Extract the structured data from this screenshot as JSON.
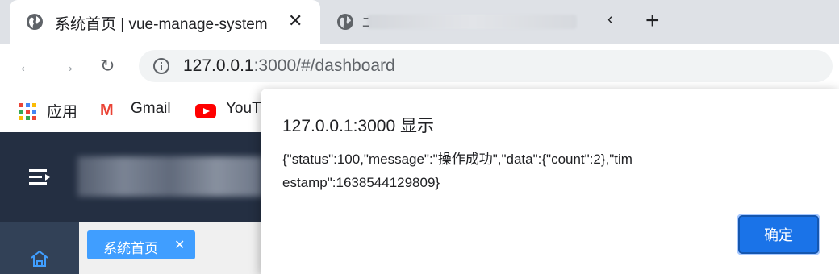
{
  "browser": {
    "active_tab": {
      "title": "系统首页 | vue-manage-system",
      "close_glyph": "✕"
    },
    "second_tab": {
      "title_fragment": "ﾆ",
      "overflow_glyph": "‹"
    },
    "new_tab_glyph": "+",
    "nav": {
      "back_glyph": "←",
      "forward_glyph": "→",
      "reload_glyph": "↻"
    },
    "address": {
      "host": "127.0.0.1",
      "rest": ":3000/#/dashboard"
    },
    "bookmarks": [
      {
        "label": "应用",
        "icon": "apps-grid-icon"
      },
      {
        "label": "Gmail",
        "icon": "gmail-icon"
      },
      {
        "label": "YouT",
        "icon": "youtube-icon"
      }
    ]
  },
  "page": {
    "tag": {
      "label": "系统首页",
      "close_glyph": "✕"
    }
  },
  "dialog": {
    "title": "127.0.0.1:3000 显示",
    "message": "{\"status\":100,\"message\":\"操作成功\",\"data\":{\"count\":2},\"timestamp\":1638544129809}",
    "ok_label": "确定"
  },
  "colors": {
    "tabstrip": "#dee1e6",
    "header": "#242f42",
    "sidebar": "#324157",
    "tag": "#409eff",
    "button": "#1a73e8"
  }
}
